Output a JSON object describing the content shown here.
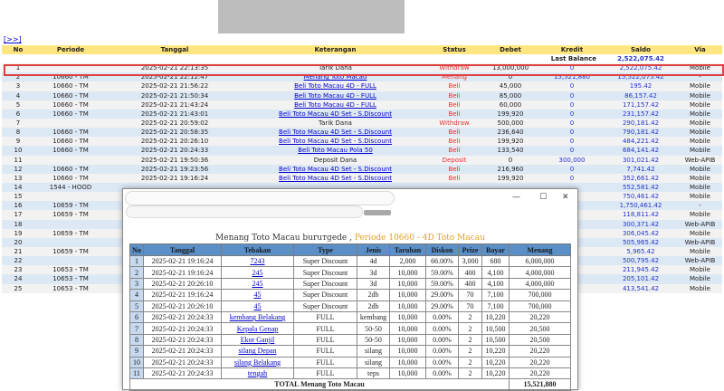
{
  "nav": {
    "link": "[>>]"
  },
  "table": {
    "headers": [
      "No",
      "Periode",
      "Tanggal",
      "Keterangan",
      "Status",
      "Debet",
      "Kredit",
      "Saldo",
      "Via"
    ],
    "last_balance_label": "Last Balance",
    "last_balance_value": "2,522,075.42",
    "rows": [
      {
        "no": "1",
        "periode": "",
        "tanggal": "2025-02-21 22:13:35",
        "ket": "Tarik Dana",
        "ket_link": false,
        "status": "Withdraw",
        "debet": "13,000,000",
        "kredit": "0",
        "saldo": "2,522,075.42",
        "via": "Mobile"
      },
      {
        "no": "2",
        "periode": "10660 - TM",
        "tanggal": "2025-02-21 22:12:47",
        "ket": "Menang Toto Macau",
        "ket_link": true,
        "status": "Menang",
        "debet": "0",
        "kredit": "15,521,880",
        "saldo": "15,522,075.42",
        "via": "-"
      },
      {
        "no": "3",
        "periode": "10660 - TM",
        "tanggal": "2025-02-21 21:56:22",
        "ket": "Beli Toto Macau 4D - FULL",
        "ket_link": true,
        "status": "Beli",
        "debet": "45,000",
        "kredit": "0",
        "saldo": "195.42",
        "via": "Mobile"
      },
      {
        "no": "4",
        "periode": "10660 - TM",
        "tanggal": "2025-02-21 21:50:34",
        "ket": "Beli Toto Macau 4D - FULL",
        "ket_link": true,
        "status": "Beli",
        "debet": "85,000",
        "kredit": "0",
        "saldo": "86,157.42",
        "via": "Mobile"
      },
      {
        "no": "5",
        "periode": "10660 - TM",
        "tanggal": "2025-02-21 21:43:24",
        "ket": "Beli Toto Macau 4D - FULL",
        "ket_link": true,
        "status": "Beli",
        "debet": "60,000",
        "kredit": "0",
        "saldo": "171,157.42",
        "via": "Mobile"
      },
      {
        "no": "6",
        "periode": "10660 - TM",
        "tanggal": "2025-02-21 21:43:01",
        "ket": "Beli Toto Macau 4D Set - S.Discount",
        "ket_link": true,
        "status": "Beli",
        "debet": "199,920",
        "kredit": "0",
        "saldo": "231,157.42",
        "via": "Mobile"
      },
      {
        "no": "7",
        "periode": "",
        "tanggal": "2025-02-21 20:59:02",
        "ket": "Tarik Dana",
        "ket_link": false,
        "status": "Withdraw",
        "debet": "500,000",
        "kredit": "0",
        "saldo": "290,181.42",
        "via": "Mobile"
      },
      {
        "no": "8",
        "periode": "10660 - TM",
        "tanggal": "2025-02-21 20:58:35",
        "ket": "Beli Toto Macau 4D Set - S.Discount",
        "ket_link": true,
        "status": "Beli",
        "debet": "236,640",
        "kredit": "0",
        "saldo": "790,181.42",
        "via": "Mobile"
      },
      {
        "no": "9",
        "periode": "10660 - TM",
        "tanggal": "2025-02-21 20:26:10",
        "ket": "Beli Toto Macau 4D Set - S.Discount",
        "ket_link": true,
        "status": "Beli",
        "debet": "199,920",
        "kredit": "0",
        "saldo": "484,221.42",
        "via": "Mobile"
      },
      {
        "no": "10",
        "periode": "10660 - TM",
        "tanggal": "2025-02-21 20:24:33",
        "ket": "Beli Toto Macau Pola 50",
        "ket_link": true,
        "status": "Beli",
        "debet": "133,540",
        "kredit": "0",
        "saldo": "684,141.42",
        "via": "Mobile"
      },
      {
        "no": "11",
        "periode": "",
        "tanggal": "2025-02-21 19:50:36",
        "ket": "Deposit Dana",
        "ket_link": false,
        "status": "Deposit",
        "debet": "0",
        "kredit": "300,000",
        "saldo": "301,021.42",
        "via": "Web-APIB"
      },
      {
        "no": "12",
        "periode": "10660 - TM",
        "tanggal": "2025-02-21 19:23:56",
        "ket": "Beli Toto Macau 4D Set - S.Discount",
        "ket_link": true,
        "status": "Beli",
        "debet": "216,960",
        "kredit": "0",
        "saldo": "7,741.42",
        "via": "Mobile"
      },
      {
        "no": "13",
        "periode": "10660 - TM",
        "tanggal": "2025-02-21 19:16:24",
        "ket": "Beli Toto Macau 4D Set - S.Discount",
        "ket_link": true,
        "status": "Beli",
        "debet": "199,920",
        "kredit": "0",
        "saldo": "352,661.42",
        "via": "Mobile"
      },
      {
        "no": "14",
        "periode": "1544 - HOOD",
        "tanggal": "",
        "ket": "",
        "ket_link": false,
        "status": "",
        "debet": "",
        "kredit": "",
        "saldo": "552,581.42",
        "via": "Mobile"
      },
      {
        "no": "15",
        "periode": "",
        "tanggal": "",
        "ket": "",
        "ket_link": false,
        "status": "",
        "debet": "",
        "kredit": "",
        "saldo": "750,461.42",
        "via": "Mobile"
      },
      {
        "no": "16",
        "periode": "10659 - TM",
        "tanggal": "",
        "ket": "",
        "ket_link": false,
        "status": "",
        "debet": "",
        "kredit": "",
        "saldo": "1,750,461.42",
        "via": "-"
      },
      {
        "no": "17",
        "periode": "10659 - TM",
        "tanggal": "",
        "ket": "",
        "ket_link": false,
        "status": "",
        "debet": "",
        "kredit": "",
        "saldo": "118,811.42",
        "via": "Mobile"
      },
      {
        "no": "18",
        "periode": "",
        "tanggal": "",
        "ket": "",
        "ket_link": false,
        "status": "",
        "debet": "",
        "kredit": "",
        "saldo": "300,371.42",
        "via": "Web-APIB"
      },
      {
        "no": "19",
        "periode": "10659 - TM",
        "tanggal": "",
        "ket": "",
        "ket_link": false,
        "status": "",
        "debet": "",
        "kredit": "",
        "saldo": "306,045.42",
        "via": "Mobile"
      },
      {
        "no": "20",
        "periode": "",
        "tanggal": "",
        "ket": "",
        "ket_link": false,
        "status": "",
        "debet": "",
        "kredit": "",
        "saldo": "505,965.42",
        "via": "Web-APIB"
      },
      {
        "no": "21",
        "periode": "10659 - TM",
        "tanggal": "",
        "ket": "",
        "ket_link": false,
        "status": "",
        "debet": "",
        "kredit": "",
        "saldo": "5,965.42",
        "via": "Mobile"
      },
      {
        "no": "22",
        "periode": "",
        "tanggal": "",
        "ket": "",
        "ket_link": false,
        "status": "",
        "debet": "",
        "kredit": "",
        "saldo": "500,795.42",
        "via": "Web-APIB"
      },
      {
        "no": "23",
        "periode": "10653 - TM",
        "tanggal": "",
        "ket": "",
        "ket_link": false,
        "status": "",
        "debet": "",
        "kredit": "",
        "saldo": "211,945.42",
        "via": "Mobile"
      },
      {
        "no": "24",
        "periode": "10653 - TM",
        "tanggal": "",
        "ket": "",
        "ket_link": false,
        "status": "",
        "debet": "",
        "kredit": "",
        "saldo": "205,101.42",
        "via": "Mobile"
      },
      {
        "no": "25",
        "periode": "10653 - TM",
        "tanggal": "",
        "ket": "",
        "ket_link": false,
        "status": "",
        "debet": "",
        "kredit": "",
        "saldo": "413,541.42",
        "via": "Mobile"
      }
    ]
  },
  "popup": {
    "window_buttons": {
      "minimize": "—",
      "maximize": "☐",
      "close": "✕"
    },
    "title_main": "Menang Toto Macau buruтgede ,",
    "title_sub": "Periode 10660 - 4D Toto Macau",
    "headers": [
      "No",
      "Tanggal",
      "Tebakan",
      "Type",
      "Jenis",
      "Taruhan",
      "Diskon",
      "Prize",
      "Bayar",
      "Menang"
    ],
    "rows": [
      {
        "no": "1",
        "tanggal": "2025-02-21 19:16:24",
        "tebakan": "7243",
        "type": "Super Discount",
        "jenis": "4d",
        "taruhan": "2,000",
        "diskon": "66.00%",
        "prize": "3,000",
        "bayar": "680",
        "menang": "6,000,000"
      },
      {
        "no": "2",
        "tanggal": "2025-02-21 19:16:24",
        "tebakan": "245",
        "type": "Super Discount",
        "jenis": "3d",
        "taruhan": "10,000",
        "diskon": "59.00%",
        "prize": "400",
        "bayar": "4,100",
        "menang": "4,000,000"
      },
      {
        "no": "3",
        "tanggal": "2025-02-21 20:26:10",
        "tebakan": "245",
        "type": "Super Discount",
        "jenis": "3d",
        "taruhan": "10,000",
        "diskon": "59.00%",
        "prize": "400",
        "bayar": "4,100",
        "menang": "4,000,000"
      },
      {
        "no": "4",
        "tanggal": "2025-02-21 19:16:24",
        "tebakan": "45",
        "type": "Super Discount",
        "jenis": "2db",
        "taruhan": "10,000",
        "diskon": "29.00%",
        "prize": "70",
        "bayar": "7,100",
        "menang": "700,000"
      },
      {
        "no": "5",
        "tanggal": "2025-02-21 20:26:10",
        "tebakan": "45",
        "type": "Super Discount",
        "jenis": "2db",
        "taruhan": "10,000",
        "diskon": "29.00%",
        "prize": "70",
        "bayar": "7,100",
        "menang": "700,000"
      },
      {
        "no": "6",
        "tanggal": "2025-02-21 20:24:33",
        "tebakan": "kembang Belakang",
        "type": "FULL",
        "jenis": "kembang",
        "taruhan": "10,000",
        "diskon": "0.00%",
        "prize": "2",
        "bayar": "10,220",
        "menang": "20,220"
      },
      {
        "no": "7",
        "tanggal": "2025-02-21 20:24:33",
        "tebakan": "Kepala Genap",
        "type": "FULL",
        "jenis": "50-50",
        "taruhan": "10,000",
        "diskon": "0.00%",
        "prize": "2",
        "bayar": "10,500",
        "menang": "20,500"
      },
      {
        "no": "8",
        "tanggal": "2025-02-21 20:24:33",
        "tebakan": "Ekor Ganjil",
        "type": "FULL",
        "jenis": "50-50",
        "taruhan": "10,000",
        "diskon": "0.00%",
        "prize": "2",
        "bayar": "10,500",
        "menang": "20,500"
      },
      {
        "no": "9",
        "tanggal": "2025-02-21 20:24:33",
        "tebakan": "silang Depan",
        "type": "FULL",
        "jenis": "silang",
        "taruhan": "10,000",
        "diskon": "0.00%",
        "prize": "2",
        "bayar": "10,220",
        "menang": "20,220"
      },
      {
        "no": "10",
        "tanggal": "2025-02-21 20:24:33",
        "tebakan": "silang Belakang",
        "type": "FULL",
        "jenis": "silang",
        "taruhan": "10,000",
        "diskon": "0.00%",
        "prize": "2",
        "bayar": "10,220",
        "menang": "20,220"
      },
      {
        "no": "11",
        "tanggal": "2025-02-21 20:24:33",
        "tebakan": "tengah",
        "type": "FULL",
        "jenis": "teps",
        "taruhan": "10,000",
        "diskon": "0.00%",
        "prize": "2",
        "bayar": "10,220",
        "menang": "20,220"
      }
    ],
    "total_label": "TOTAL  Menang Toto Macau",
    "total_value": "15,521,880"
  }
}
